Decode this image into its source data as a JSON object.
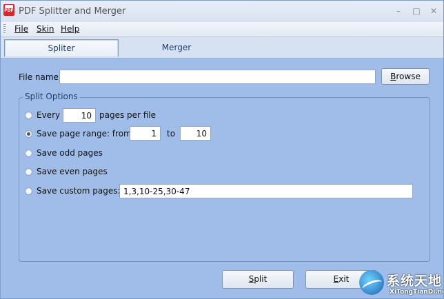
{
  "window": {
    "title": "PDF Splitter and Merger",
    "icon_text": "PDF",
    "controls": {
      "minimize": "–",
      "maximize": "□",
      "close": "✕"
    }
  },
  "menu": [
    "File",
    "Skin",
    "Help"
  ],
  "tabs": [
    {
      "label": "Spliter",
      "active": true
    },
    {
      "label": "Merger",
      "active": false
    }
  ],
  "file": {
    "label": "File name:",
    "value": "",
    "browse_label": "Browse",
    "browse_accel": "B",
    "browse_rest": "rowse"
  },
  "split_options": {
    "title": "Split Options",
    "every": {
      "label": "Every",
      "value": "10",
      "suffix": "pages per file",
      "selected": false
    },
    "range": {
      "label": "Save page range: from",
      "from": "1",
      "to_label": "to",
      "to": "10",
      "selected": true
    },
    "odd": {
      "label": "Save odd pages",
      "selected": false
    },
    "even": {
      "label": "Save even pages",
      "selected": false
    },
    "custom": {
      "label": "Save custom pages:",
      "value": "1,3,10-25,30-47",
      "selected": false
    }
  },
  "buttons": {
    "split": {
      "accel": "S",
      "rest": "plit"
    },
    "exit": {
      "accel": "E",
      "rest": "xit"
    }
  },
  "watermark": {
    "title": "系统天地",
    "subtitle": "XiTongTianDi.net"
  },
  "colors": {
    "background": "#9fbde8",
    "tab_text": "#1f3f72",
    "group_border": "#6f91c4"
  }
}
